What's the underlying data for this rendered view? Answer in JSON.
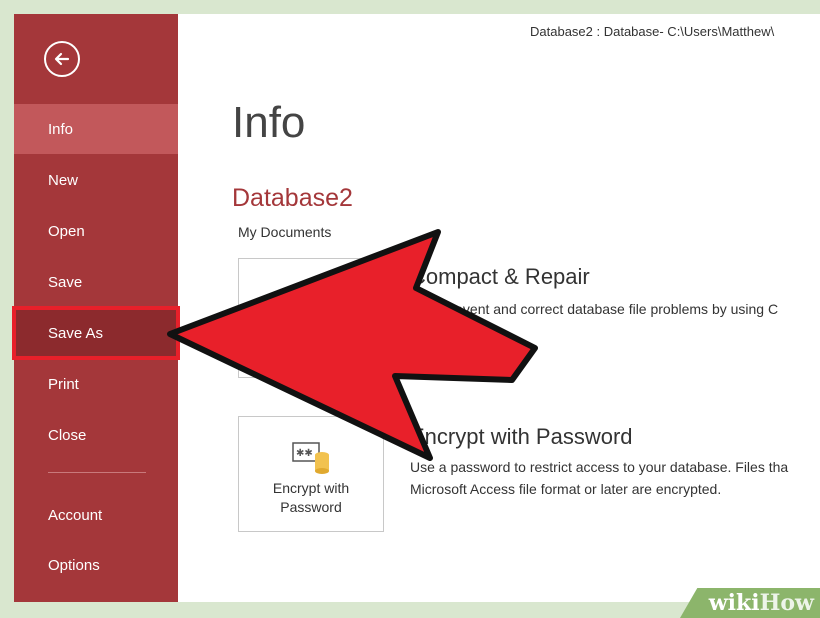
{
  "titlebar": {
    "text": "Database2 : Database- C:\\Users\\Matthew\\"
  },
  "sidebar": {
    "items": [
      {
        "label": "Info"
      },
      {
        "label": "New"
      },
      {
        "label": "Open"
      },
      {
        "label": "Save"
      },
      {
        "label": "Save As"
      },
      {
        "label": "Print"
      },
      {
        "label": "Close"
      },
      {
        "label": "Account"
      },
      {
        "label": "Options"
      }
    ],
    "active": "Info",
    "highlighted": "Save As"
  },
  "main": {
    "page_title": "Info",
    "db_name": "Database2",
    "db_path": "My Documents",
    "compact": {
      "heading": "Compact & Repair",
      "desc": "Help prevent and correct database file problems by using C"
    },
    "encrypt": {
      "tile_line1": "Encrypt with",
      "tile_line2": "Password",
      "heading": "Encrypt with Password",
      "desc_line1": "Use a password to restrict access to your database. Files tha",
      "desc_line2": "Microsoft Access file format or later are encrypted."
    }
  },
  "watermark": {
    "wiki": "wiki",
    "how": "How"
  },
  "colors": {
    "sidebar": "#a4373a",
    "arrow": "#e8202a",
    "accent_text": "#a4373a"
  }
}
